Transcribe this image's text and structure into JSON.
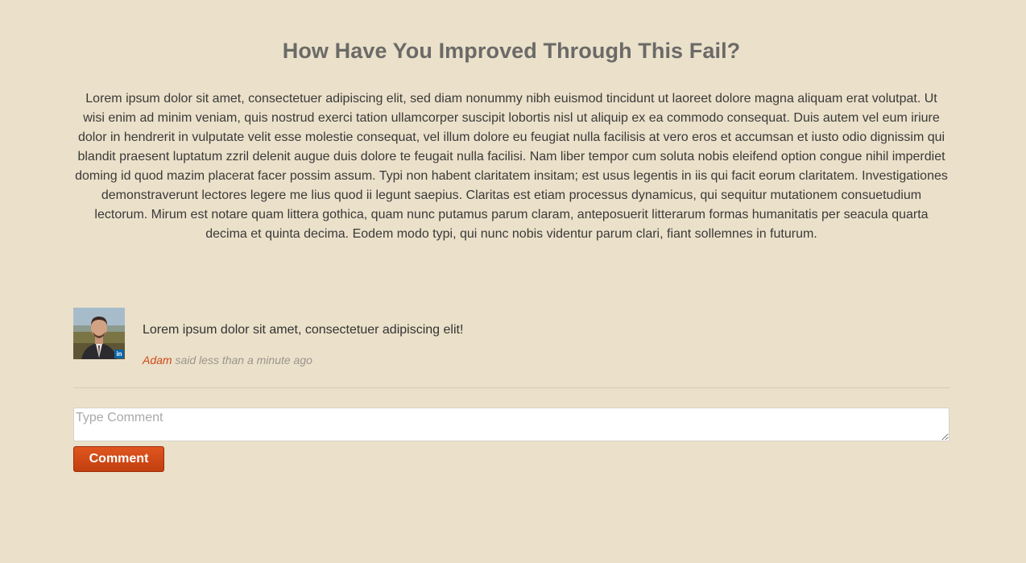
{
  "header": {
    "title": "How Have You Improved Through This Fail?"
  },
  "main": {
    "body_text": "Lorem ipsum dolor sit amet, consectetuer adipiscing elit, sed diam nonummy nibh euismod tincidunt ut laoreet dolore magna aliquam erat volutpat. Ut wisi enim ad minim veniam, quis nostrud exerci tation ullamcorper suscipit lobortis nisl ut aliquip ex ea commodo consequat. Duis autem vel eum iriure dolor in hendrerit in vulputate velit esse molestie consequat, vel illum dolore eu feugiat nulla facilisis at vero eros et accumsan et iusto odio dignissim qui blandit praesent luptatum zzril delenit augue duis dolore te feugait nulla facilisi. Nam liber tempor cum soluta nobis eleifend option congue nihil imperdiet doming id quod mazim placerat facer possim assum. Typi non habent claritatem insitam; est usus legentis in iis qui facit eorum claritatem. Investigationes demonstraverunt lectores legere me lius quod ii legunt saepius. Claritas est etiam processus dynamicus, qui sequitur mutationem consuetudium lectorum. Mirum est notare quam littera gothica, quam nunc putamus parum claram, anteposuerit litterarum formas humanitatis per seacula quarta decima et quinta decima. Eodem modo typi, qui nunc nobis videntur parum clari, fiant sollemnes in futurum."
  },
  "comments": [
    {
      "text": "Lorem ipsum dolor sit amet, consectetuer adipiscing elit!",
      "author": "Adam",
      "meta": "said less than a minute ago",
      "badge": "in",
      "badge_icon": "linkedin-icon"
    }
  ],
  "comment_form": {
    "placeholder": "Type Comment",
    "value": "",
    "submit_label": "Comment"
  },
  "colors": {
    "background": "#ebe0c9",
    "accent": "#cc4a17",
    "button": "#c9461a",
    "linkedin": "#0b66a8"
  }
}
